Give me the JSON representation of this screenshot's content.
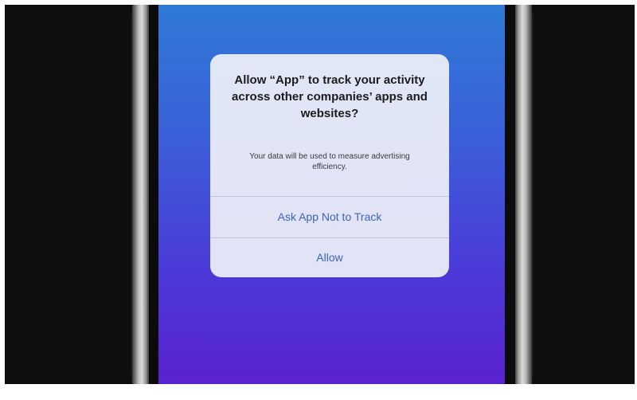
{
  "tracking_prompt": {
    "title": "Allow “App” to track your activity across other companies’ apps and websites?",
    "message": "Your data will be used to measure advertising efficiency.",
    "deny_label": "Ask App Not to Track",
    "allow_label": "Allow"
  },
  "colors": {
    "screen_gradient_top": "#2f7ad6",
    "screen_gradient_bottom": "#5a22cf",
    "button_text": "#3a64c4",
    "dialog_background": "#eef0f7"
  }
}
